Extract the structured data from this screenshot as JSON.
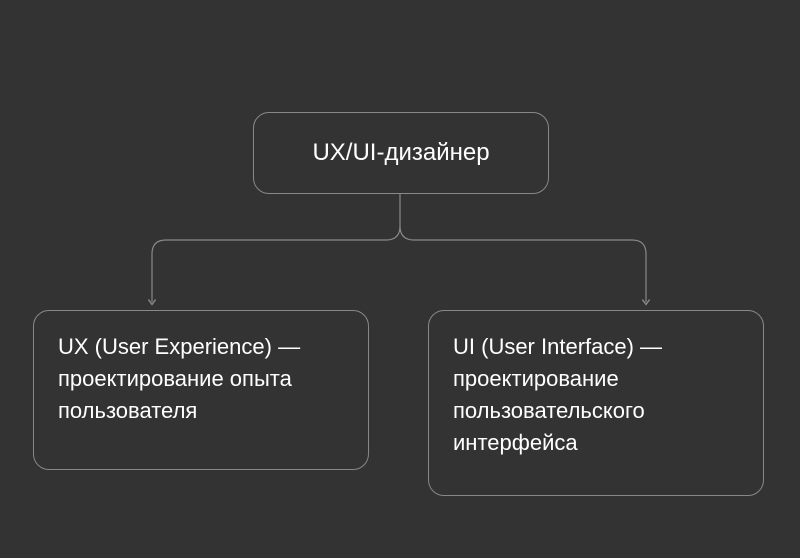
{
  "diagram": {
    "root": {
      "label": "UX/UI-дизайнер"
    },
    "left": {
      "label": "UX (User Experience) — проектирование опыта пользователя"
    },
    "right": {
      "label": "UI (User Interface) — проектирование пользовательского интерфейса"
    }
  }
}
